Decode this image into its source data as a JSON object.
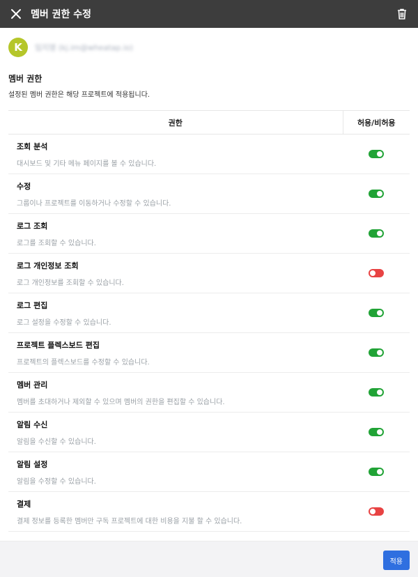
{
  "header": {
    "title": "멤버 권한 수정",
    "icons": {
      "close": "close-icon",
      "trash": "trash-icon"
    }
  },
  "user": {
    "initial": "K",
    "name": "임지영 (kj.im@wheatap.io)",
    "avatar_color": "#b5c62a"
  },
  "section": {
    "title": "멤버 권한",
    "description": "설정된 멤버 권한은 해당 프로젝트에 적용됩니다."
  },
  "table": {
    "headers": {
      "permission": "권한",
      "toggle": "허용/비허용"
    },
    "rows": [
      {
        "name": "조회 분석",
        "desc": "대시보드 및 기타 메뉴 페이지를 볼 수 있습니다.",
        "allowed": true
      },
      {
        "name": "수정",
        "desc": "그룹이나 프로젝트를 이동하거나 수정할 수 있습니다.",
        "allowed": true
      },
      {
        "name": "로그 조회",
        "desc": "로그를 조회할 수 있습니다.",
        "allowed": true
      },
      {
        "name": "로그 개인정보 조회",
        "desc": "로그 개인정보를 조회할 수 있습니다.",
        "allowed": false
      },
      {
        "name": "로그 편집",
        "desc": "로그 설정을 수정할 수 있습니다.",
        "allowed": true
      },
      {
        "name": "프로젝트 플렉스보드 편집",
        "desc": "프로젝트의 플렉스보드를 수정할 수 있습니다.",
        "allowed": true
      },
      {
        "name": "멤버 관리",
        "desc": "멤버를 초대하거나 제외할 수 있으며 멤버의 권한을 편집할 수 있습니다.",
        "allowed": true
      },
      {
        "name": "알림 수신",
        "desc": "알림을 수신할 수 있습니다.",
        "allowed": true
      },
      {
        "name": "알림 설정",
        "desc": "알림을 수정할 수 있습니다.",
        "allowed": true
      },
      {
        "name": "결제",
        "desc": "결제 정보를 등록한 멤버만 구독 프로젝트에 대한 비용을 지불 할 수 있습니다.",
        "allowed": false
      }
    ]
  },
  "colors": {
    "header_bg": "#3d3d3d",
    "toggle_on": "#21a336",
    "toggle_off": "#e84343",
    "primary": "#2f6fe0"
  },
  "footer": {
    "apply_label": "적용"
  }
}
